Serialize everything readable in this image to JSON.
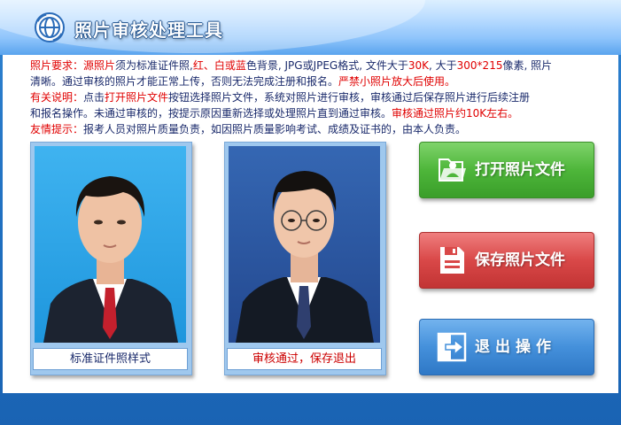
{
  "app": {
    "title": "照片审核处理工具"
  },
  "info": {
    "line1": {
      "label": "照片要求：",
      "src": "源照片",
      "t1": "须为标准证件照,",
      "colors": "红、白或蓝",
      "t2": "色背景, JPG或JPEG格式, 文件大于",
      "size_min": "30K",
      "t3": ", 大于",
      "dims": "300*215",
      "t4": "像素, 照片"
    },
    "line2": {
      "t1": "清晰。通过审核的照片才能正常上传，否则无法完成注册和报名。",
      "warn": "严禁小照片放大后使用。"
    },
    "line3": {
      "label": "有关说明：",
      "t1": "点击",
      "open": "打开照片文件",
      "t2": "按钮选择照片文件，系统对照片进行审核，审核通过后保存照片进行后续注册"
    },
    "line4": {
      "t1": "和报名操作。未通过审核的，按提示原因重新选择或处理照片直到通过审核。",
      "result": "审核通过照片约10K左右。"
    },
    "line5": {
      "label": "友情提示：",
      "t1": "报考人员对照片质量负责，如因照片质量影响考试、成绩及证书的，由本人负责。"
    }
  },
  "photos": {
    "sample_caption": "标准证件照样式",
    "sample_bg": "#2ba3e6",
    "result_caption": "审核通过，保存退出",
    "result_bg": "#2d5aa6",
    "result_caption_color": "#cc0000",
    "sample_caption_color": "#1a2a6b"
  },
  "buttons": {
    "open": {
      "label": "打开照片文件",
      "icon": "open-file-icon",
      "color": "#4eb63a"
    },
    "save": {
      "label": "保存照片文件",
      "icon": "save-disk-icon",
      "color": "#d94848"
    },
    "exit": {
      "label": "退出操作",
      "icon": "exit-arrow-icon",
      "color": "#4490db"
    }
  }
}
